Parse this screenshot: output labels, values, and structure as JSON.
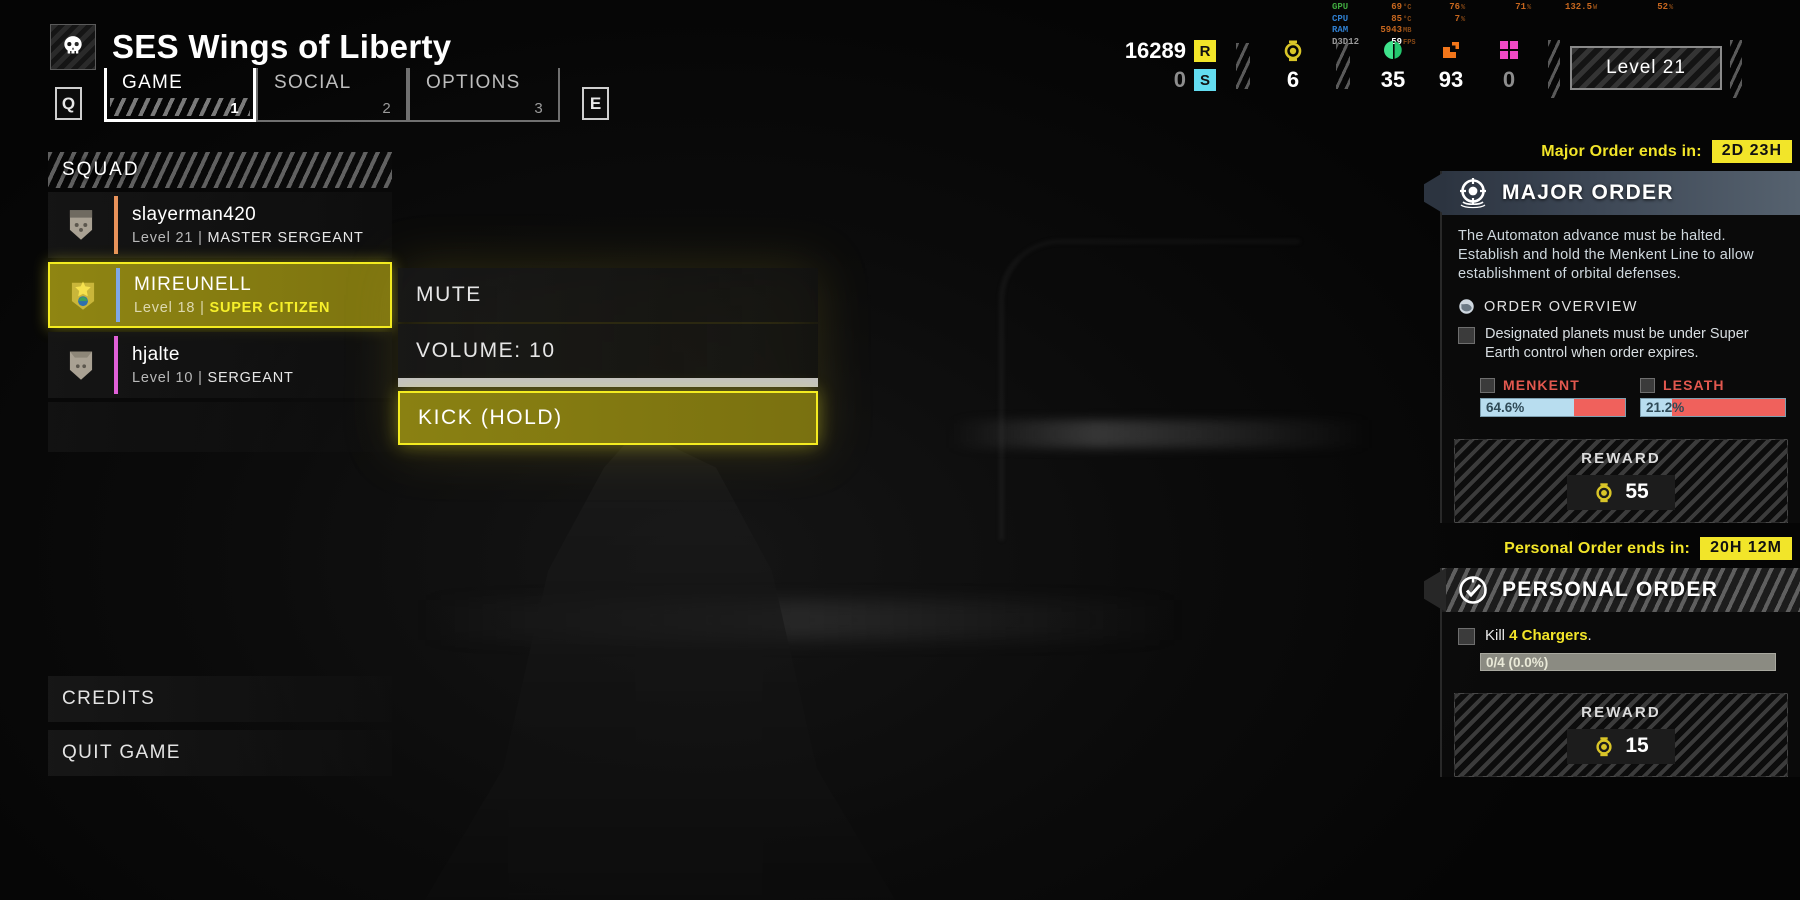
{
  "header": {
    "ship_name": "SES Wings of Liberty",
    "ship_icon": "skull-icon",
    "left_key": "Q",
    "right_key": "E",
    "tabs": [
      {
        "label": "GAME",
        "num": "1",
        "active": true
      },
      {
        "label": "SOCIAL",
        "num": "2",
        "active": false
      },
      {
        "label": "OPTIONS",
        "num": "3",
        "active": false
      }
    ],
    "level_badge": "Level 21",
    "resources": {
      "requisition": {
        "value": "16289",
        "icon": "requisition-icon",
        "glyph": "R"
      },
      "samples_rare": {
        "value": "0",
        "icon": "sample-icon",
        "glyph": "S"
      },
      "medals": {
        "value": "6",
        "icon": "medal-icon"
      },
      "common_samples": {
        "value": "35",
        "icon": "common-sample-icon"
      },
      "rare_samples": {
        "value": "93",
        "icon": "rare-sample-icon"
      },
      "super_samples": {
        "value": "0",
        "icon": "super-sample-icon"
      }
    },
    "perf_overlay": {
      "rows": [
        {
          "label": "GPU",
          "value": "69",
          "unit": "°C",
          "extra1": "76",
          "extra1u": "%",
          "extra2": "71",
          "extra2u": "%",
          "extra3": "132.5",
          "extra3u": "W",
          "extra4": "52",
          "extra4u": "%"
        },
        {
          "label": "CPU",
          "value": "85",
          "unit": "°C",
          "extra1": "7",
          "extra1u": "%",
          "extra2": "",
          "extra2u": "",
          "extra3": "",
          "extra3u": "",
          "extra4": "",
          "extra4u": ""
        },
        {
          "label": "RAM",
          "value": "5943",
          "unit": "MB",
          "extra1": "",
          "extra1u": "",
          "extra2": "",
          "extra2u": "",
          "extra3": "",
          "extra3u": "",
          "extra4": "",
          "extra4u": ""
        },
        {
          "label": "D3D12",
          "value": "59",
          "unit": "FPS",
          "extra1": "",
          "extra1u": "",
          "extra2": "",
          "extra2u": "",
          "extra3": "",
          "extra3u": "",
          "extra4": "",
          "extra4u": ""
        }
      ]
    }
  },
  "squad": {
    "title": "SQUAD",
    "members": [
      {
        "name": "slayerman420",
        "level_text": "Level 21",
        "separator": " | ",
        "rank": "MASTER SERGEANT",
        "accent_color": "#e8925a",
        "rank_icon": "chevron-rank-icon",
        "selected": false
      },
      {
        "name": "MIREUNELL",
        "level_text": "Level 18",
        "separator": " | ",
        "rank": "SUPER CITIZEN",
        "accent_color": "#7fa8e8",
        "rank_icon": "star-laurel-rank-icon",
        "selected": true
      },
      {
        "name": "hjalte",
        "level_text": "Level 10",
        "separator": " | ",
        "rank": "SERGEANT",
        "accent_color": "#e060d8",
        "rank_icon": "shield-rank-icon",
        "selected": false
      }
    ]
  },
  "context_menu": {
    "mute_label": "MUTE",
    "volume_label": "VOLUME: 10",
    "volume_value": 10,
    "volume_max": 10,
    "volume_fill_pct": 100,
    "kick_label": "KICK (HOLD)"
  },
  "bottom_menu": {
    "credits": "CREDITS",
    "quit": "QUIT GAME"
  },
  "major_order": {
    "ends_label": "Major Order ends in:",
    "ends_value": "2D 23H",
    "banner_title": "MAJOR ORDER",
    "banner_icon": "crosshair-target-icon",
    "description": "The Automaton advance must be halted. Establish and hold the Menkent Line to allow establishment of orbital defenses.",
    "overview_label": "ORDER OVERVIEW",
    "overview_icon": "planet-globe-icon",
    "task": "Designated planets must be under Super Earth control when order expires.",
    "planets": [
      {
        "name": "MENKENT",
        "pct_text": "64.6%",
        "pct": 64.6
      },
      {
        "name": "LESATH",
        "pct_text": "21.2%",
        "pct": 21.2
      }
    ],
    "reward_label": "REWARD",
    "reward_value": "55",
    "reward_icon": "medal-icon"
  },
  "personal_order": {
    "ends_label": "Personal Order ends in:",
    "ends_value": "20H 12M",
    "banner_title": "PERSONAL ORDER",
    "banner_icon": "check-circle-icon",
    "task_prefix": "Kill ",
    "task_highlight": "4 Chargers",
    "task_suffix": ".",
    "progress_text": "0/4 (0.0%)",
    "progress_pct": 0,
    "reward_label": "REWARD",
    "reward_value": "15",
    "reward_icon": "medal-icon"
  },
  "colors": {
    "accent_yellow": "#f2e529",
    "selected_bg": "#8f8512",
    "planet_red": "#f0615c",
    "planet_blue": "#b8ddef"
  }
}
